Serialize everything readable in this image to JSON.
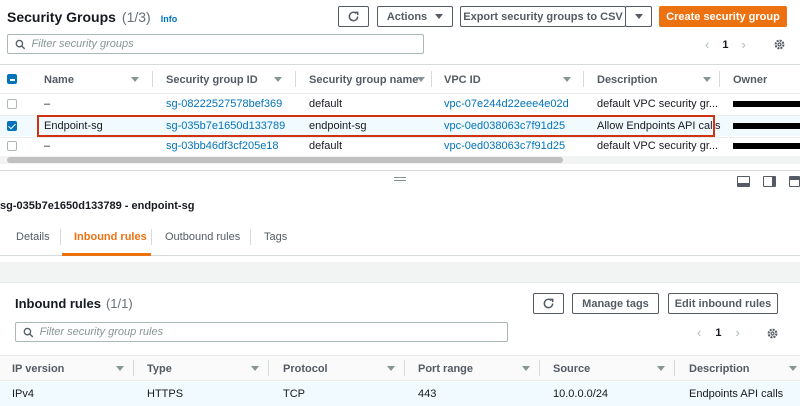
{
  "top": {
    "title": "Security Groups",
    "count": "(1/3)",
    "info": "Info",
    "refresh_icon": "refresh-icon",
    "actions_label": "Actions",
    "export_label": "Export security groups to CSV",
    "create_label": "Create security group",
    "search_placeholder": "Filter security groups",
    "page": "1"
  },
  "table": {
    "columns": [
      "Name",
      "Security group ID",
      "Security group name",
      "VPC ID",
      "Description",
      "Owner"
    ],
    "rows": [
      {
        "selected": false,
        "name": "–",
        "id": "sg-08222527578bef369",
        "group_name": "default",
        "vpc": "vpc-07e244d22eee4e02d",
        "description": "default VPC security gr..."
      },
      {
        "selected": true,
        "name": "Endpoint-sg",
        "id": "sg-035b7e1650d133789",
        "group_name": "endpoint-sg",
        "vpc": "vpc-0ed038063c7f91d25",
        "description": "Allow Endpoints API calls"
      },
      {
        "selected": false,
        "name": "–",
        "id": "sg-03bb46df3cf205e18",
        "group_name": "default",
        "vpc": "vpc-0ed038063c7f91d25",
        "description": "default VPC security gr..."
      }
    ],
    "highlight_color": "#d13212"
  },
  "detail": {
    "heading": "sg-035b7e1650d133789 - endpoint-sg",
    "tabs": [
      "Details",
      "Inbound rules",
      "Outbound rules",
      "Tags"
    ],
    "active_tab": 1,
    "accent": "#ec7211"
  },
  "inbound": {
    "title": "Inbound rules",
    "count": "(1/1)",
    "manage_tags_label": "Manage tags",
    "edit_label": "Edit inbound rules",
    "search_placeholder": "Filter security group rules",
    "page": "1",
    "columns": [
      "IP version",
      "Type",
      "Protocol",
      "Port range",
      "Source",
      "Description"
    ],
    "rows": [
      {
        "ip_version": "IPv4",
        "type": "HTTPS",
        "protocol": "TCP",
        "port_range": "443",
        "source": "10.0.0.0/24",
        "description": "Endpoints API calls"
      }
    ]
  }
}
